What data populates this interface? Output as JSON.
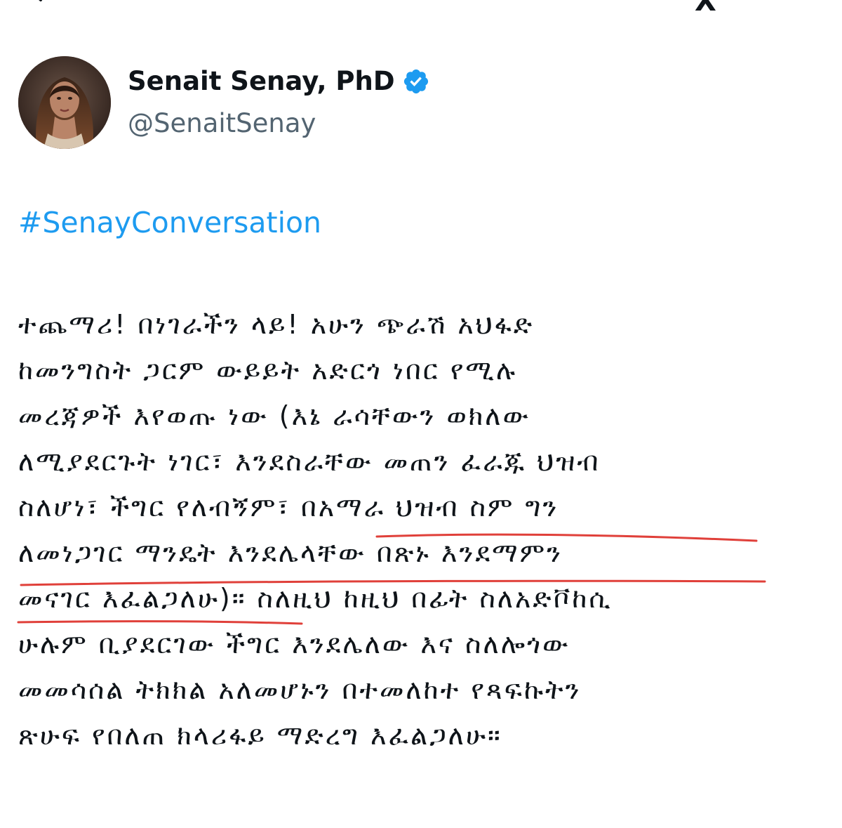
{
  "window": {
    "close_glyph": "X"
  },
  "icons": {
    "back": "back-arrow-icon",
    "verified": "verified-badge-icon"
  },
  "colors": {
    "hashtag": "#1d9bf0",
    "verified": "#1d9bf0",
    "handle": "#536471",
    "underline": "#e0403a"
  },
  "author": {
    "display_name": "Senait Senay, PhD",
    "handle": "@SenaitSenay"
  },
  "tweet": {
    "hashtag": "#SenayConversation",
    "lines": [
      "ተጨማሪ! በነገራችን ላይ! አሁን ጭራሽ አህፋድ",
      "ከመንግስት ጋርም ውይይት አድርጎ ነበር የሚሉ",
      "መረጃዎች እየወጡ ነው (እኔ ራሳቸውን ወክለው",
      "ለሚያደርጉት ነገር፣ እንደስራቸው መጠን ፈራጁ ህዝብ",
      "ስለሆነ፣ ችግር የለብኝም፣ በአማራ ህዝብ ስም ግን",
      "ለመነጋገር ማንዴት እንደሌላቸው በጽኑ እንደማምን",
      "መናገር እፈልጋለሁ)። ስለዚህ ከዚህ በፊት ስለአድቮከሲ",
      "ሁሉም ቢያደርገው ችግር እንደሌለው እና ስለሎጎው",
      "መመሳሰል ትክክል አለመሆኑን በተመለከተ  የጻፍኩትን",
      "ጽሁፍ የበለጠ ክላሪፋይ ማድረግ እፈልጋለሁ።"
    ]
  }
}
